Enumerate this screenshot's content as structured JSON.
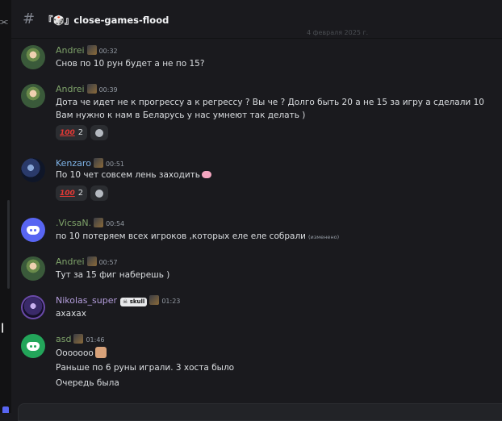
{
  "channel": {
    "name": "『🎲』close-games-flood",
    "date_peek": "4 февраля 2025 г."
  },
  "colors": {
    "andrei": "#7fa36a",
    "kenzaro": "#7fb4e8",
    "vicsan": "#7fa36a",
    "nikolas": "#b39ddb",
    "asd": "#7fa36a"
  },
  "messages": [
    {
      "user": "Andrei",
      "time": "00:32",
      "avatar": "andrei-avatar",
      "lines": [
        "Снов по 10 рун будет а не по 15?"
      ]
    },
    {
      "user": "Andrei",
      "time": "00:39",
      "avatar": "andrei-avatar",
      "lines": [
        "Дота че идет не к прогрессу а к регрессу ? Вы че ? Долго быть 20 а не 15 за игру а сделали 10",
        "Вам нужно к нам в Беларусь у нас умнеют так делать )"
      ],
      "reaction_count": "2"
    },
    {
      "user": "Kenzaro",
      "time": "00:51",
      "avatar": "kenzaro-avatar",
      "lines": [
        "По 10 чет совсем лень заходить"
      ],
      "reaction_count": "2"
    },
    {
      "user": ".VicsaN.",
      "time": "00:54",
      "avatar": "discord-avatar",
      "lines": [
        "по 10 потеряем всех игроков ,которых еле еле собрали"
      ],
      "edited": "(изменено)"
    },
    {
      "user": "Andrei",
      "time": "00:57",
      "avatar": "andrei-avatar",
      "lines": [
        "Тут за 15 фиг наберешь )"
      ]
    },
    {
      "user": "Nikolas_super",
      "time": "01:23",
      "avatar": "nikolas-avatar",
      "tag": "skull",
      "lines": [
        "ахахах"
      ]
    },
    {
      "user": "asd",
      "time": "01:46",
      "avatar": "discord-avatar",
      "lines": [
        "Ооооооо",
        "Раньше по 6 руны играли.  3 хоста было",
        "Очередь была"
      ]
    }
  ]
}
